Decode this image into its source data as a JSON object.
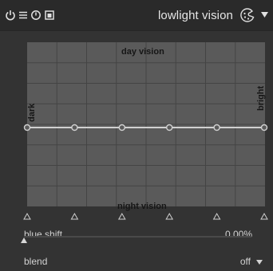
{
  "header": {
    "title": "lowlight vision",
    "icons": [
      "power-icon",
      "menu-icon",
      "reset-icon",
      "presets-icon",
      "preset-palette-icon",
      "dropdown-arrow-icon"
    ]
  },
  "graph": {
    "top_label": "day vision",
    "bottom_label": "night vision",
    "left_label": "dark",
    "right_label": "bright",
    "curve_nodes": [
      0.0,
      0.2,
      0.4,
      0.6,
      0.8,
      1.0
    ],
    "curve_level": 0.5,
    "colors": {
      "background": "#5a5a5a",
      "grid": "#444444",
      "curve": "#d0d0d0"
    }
  },
  "blue_shift": {
    "label": "blue shift",
    "value": "0.00%",
    "fraction": 0.0
  },
  "blend": {
    "label": "blend",
    "value": "off"
  }
}
